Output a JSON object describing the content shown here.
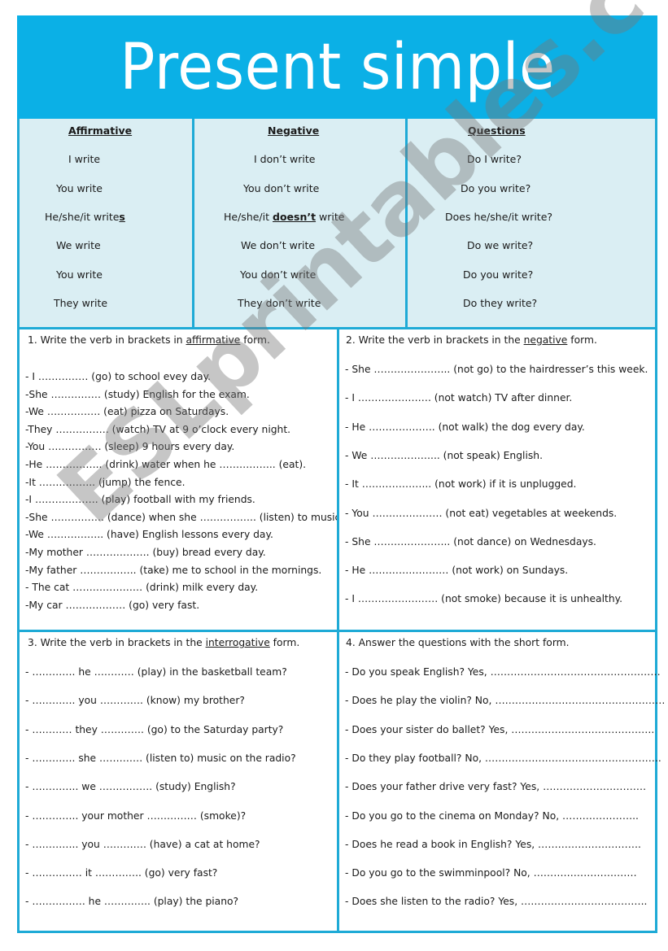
{
  "title": "Present simple",
  "colors": {
    "header_bg": "#0bb0e6",
    "border": "#1eaad6",
    "table_bg": "#daeef3"
  },
  "conjugation": {
    "affirmative": {
      "heading": "Affirmative",
      "rows": [
        "I write",
        "You write",
        "He/she/it write",
        "We write",
        "You write",
        "They write"
      ],
      "emphasis_suffix": "s"
    },
    "negative": {
      "heading": "Negative",
      "rows": [
        "I don’t write",
        "You don’t write",
        "He/she/it ",
        "We don’t write",
        "You don’t write",
        "They don’t write"
      ],
      "emphasis_word": "doesn’t",
      "emphasis_after": " write"
    },
    "questions": {
      "heading": "Questions",
      "rows": [
        "Do I write?",
        "Do you write?",
        "Does he/she/it write?",
        "Do we write?",
        "Do you write?",
        "Do they write?"
      ]
    }
  },
  "exercises": [
    {
      "instr_pre": "1.   Write the verb in brackets in ",
      "instr_key": "affirmative",
      "instr_post": " form.",
      "lines": [
        " - I …………… (go) to school evey day.",
        "-She …………… (study) English for the exam.",
        "-We ……………. (eat) pizza on Saturdays.",
        "-They ……………. (watch) TV at 9 o’clock every night.",
        "-You ……………. (sleep) 9 hours every day.",
        "-He …………….. (drink) water when he …………….. (eat).",
        "-It …………….. (jump) the fence.",
        "-I ………………. (play) football with my friends.",
        "-She ……………. (dance) when she …………….. (listen) to music.",
        "-We …………….. (have) English lessons every day.",
        "-My mother ………………. (buy) bread every day.",
        "-My father …………….. (take) me to school in the mornings.",
        "- The cat ………………… (drink) milk every day.",
        "-My car ……………… (go) very fast."
      ]
    },
    {
      "instr_pre": "2.  Write the verb in brackets in the ",
      "instr_key": "negative",
      "instr_post": " form.",
      "lines": [
        "- She ………………….. (not go) to the hairdresser’s this week.",
        "- I …………………. (not watch) TV after dinner.",
        "- He ……………….. (not walk) the dog every day.",
        "- We ………………... (not speak) English.",
        "- It ………………... (not work) if it is unplugged.",
        "- You ………………… (not eat) vegetables at weekends.",
        "- She ………………….. (not dance) on Wednesdays.",
        "- He …………………… (not work) on Sundays.",
        "- I …………………… (not smoke) because it is unhealthy."
      ]
    },
    {
      "instr_pre": "3.  Write the verb in brackets in the ",
      "instr_key": "interrogative",
      "instr_post": " form.",
      "lines": [
        "- …………. he ………… (play) in the basketball team?",
        "- …………. you …………. (know) my brother?",
        "- ………… they …………. (go) to the Saturday party?",
        "- …………. she …………. (listen to) music on the radio?",
        "- ………….. we ……………. (study) English?",
        "- ………….. your mother …………… (smoke)?",
        "- ………….. you …………. (have) a cat at home?",
        "- …………… it ………….. (go) very fast?",
        "- ……………. he ………….. (play) the piano?"
      ]
    },
    {
      "instr_pre": "4. Answer the questions with the short form.",
      "instr_key": "",
      "instr_post": "",
      "lines": [
        "- Do you speak English? Yes, ……………………………………………",
        "- Does he play the violin? No, ……………………………………………",
        "- Does your sister do ballet? Yes, …………………………………….",
        "- Do they play football? No, ……………………………………………..",
        "- Does your father drive very fast? Yes, ………………………….",
        "- Do you go to the cinema on Monday? No, …………………..",
        "- Does he read a book in English? Yes, ………………………….",
        "- Do you go to the swimminpool? No, ………………………….",
        "- Does she listen to the radio? Yes, ……………………………….."
      ]
    }
  ],
  "watermark": "ESLprintables.com"
}
